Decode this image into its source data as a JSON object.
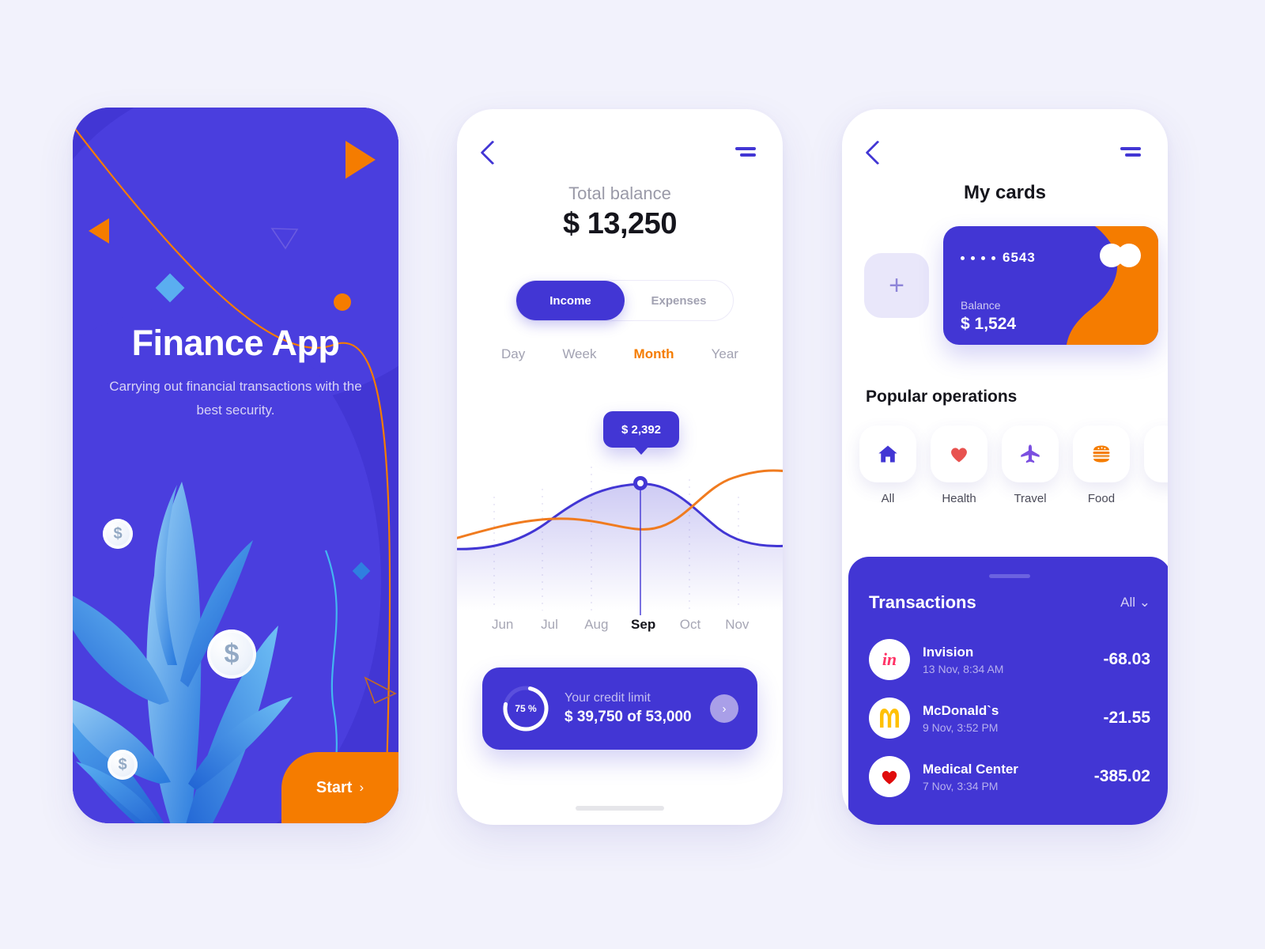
{
  "onboarding": {
    "title": "Finance App",
    "subtitle": "Carrying out financial transactions with the best security.",
    "start_label": "Start",
    "start_chevron": "›",
    "coin_symbol": "$",
    "colors": {
      "primary": "#4236d4",
      "accent": "#f57c00",
      "leaf": "#2f8fe8"
    }
  },
  "statistics": {
    "back_icon": "chevron-left-icon",
    "menu_icon": "menu-icon",
    "balance_label": "Total balance",
    "balance_value": "$ 13,250",
    "segments": [
      {
        "label": "Income",
        "active": true
      },
      {
        "label": "Expenses",
        "active": false
      }
    ],
    "periods": [
      {
        "label": "Day",
        "active": false
      },
      {
        "label": "Week",
        "active": false
      },
      {
        "label": "Month",
        "active": true
      },
      {
        "label": "Year",
        "active": false
      }
    ],
    "tooltip_value": "$ 2,392",
    "credit": {
      "percent": "75 %",
      "percent_value": 75,
      "label": "Your credit limit",
      "value": "$ 39,750 of 53,000",
      "go_icon": "›"
    }
  },
  "cards": {
    "back_icon": "chevron-left-icon",
    "menu_icon": "menu-icon",
    "title": "My cards",
    "add_card_icon": "+",
    "card": {
      "masked_number": "6543",
      "balance_label": "Balance",
      "balance_value": "$ 1,524",
      "brand_icon": "mastercard-icon"
    },
    "operations_title": "Popular operations",
    "operations": [
      {
        "label": "All",
        "icon": "home-icon",
        "color": "#4236d4"
      },
      {
        "label": "Health",
        "icon": "heart-icon",
        "color": "#e8524f"
      },
      {
        "label": "Travel",
        "icon": "airplane-icon",
        "color": "#7b4fe0"
      },
      {
        "label": "Food",
        "icon": "burger-icon",
        "color": "#f57c00"
      }
    ],
    "transactions_title": "Transactions",
    "transactions_filter": "All",
    "transactions_filter_chevron": "⌄",
    "transactions": [
      {
        "name": "Invision",
        "date": "13 Nov, 8:34 AM",
        "amount": "-68.03",
        "icon": "invision-logo"
      },
      {
        "name": "McDonald`s",
        "date": "9 Nov, 3:52  PM",
        "amount": "-21.55",
        "icon": "mcdonalds-logo"
      },
      {
        "name": "Medical Center",
        "date": "7 Nov, 3:34 PM",
        "amount": "-385.02",
        "icon": "heart-icon"
      }
    ]
  },
  "chart_data": {
    "type": "line",
    "title": "",
    "x": [
      "Jun",
      "Jul",
      "Aug",
      "Sep",
      "Oct",
      "Nov"
    ],
    "highlight_x": "Sep",
    "highlight_value": 2392,
    "series": [
      {
        "name": "Income",
        "color": "#4236d4",
        "values": [
          380,
          620,
          1780,
          2392,
          1420,
          700
        ],
        "filled": true
      },
      {
        "name": "Expenses",
        "color": "#f57c00",
        "values": [
          980,
          1420,
          1180,
          1120,
          1900,
          2280
        ],
        "filled": false
      }
    ],
    "ylim": [
      0,
      2600
    ],
    "grid": true,
    "legend": "none",
    "xlabel": "",
    "ylabel": ""
  }
}
